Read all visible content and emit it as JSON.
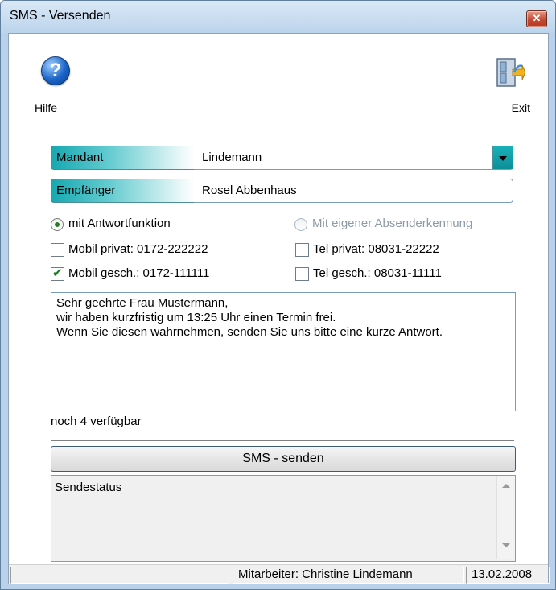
{
  "window": {
    "title": "SMS - Versenden",
    "close_glyph": "✕"
  },
  "toolbar": {
    "help_label": "Hilfe",
    "help_glyph": "?",
    "exit_label": "Exit"
  },
  "fields": {
    "mandant_label": "Mandant",
    "mandant_value": "Lindemann",
    "empfaenger_label": "Empfänger",
    "empfaenger_value": "Rosel Abbenhaus"
  },
  "options": {
    "radio_answer": "mit Antwortfunktion",
    "radio_own_sender": "Mit eigener Absenderkennung",
    "mobil_privat": "Mobil privat: 0172-222222",
    "mobil_gesch": "Mobil gesch.: 0172-111111",
    "tel_privat": "Tel privat: 08031-22222",
    "tel_gesch": "Tel gesch.: 08031-11111"
  },
  "message": {
    "line1": "Sehr geehrte Frau Mustermann,",
    "line2": "wir haben kurzfristig um 13:25 Uhr einen Termin frei.",
    "line3": "Wenn Sie diesen wahrnehmen, senden Sie uns bitte eine kurze Antwort.",
    "remaining": "noch 4 verfügbar"
  },
  "send_button": "SMS - senden",
  "status": {
    "label": "Sendestatus"
  },
  "statusbar": {
    "employee": "Mitarbeiter:  Christine Lindemann",
    "date": "13.02.2008"
  },
  "colors": {
    "label_gradient_start": "#17a8b0",
    "dropdown_button": "#0c8f98",
    "checkmark": "#1a7a1a"
  }
}
